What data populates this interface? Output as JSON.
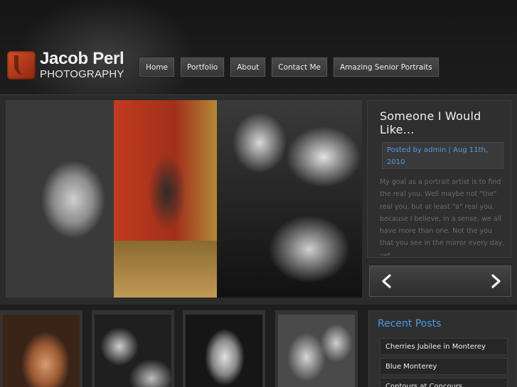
{
  "site": {
    "logo_name": "Jacob Perl",
    "logo_sub": "PHOTOGRAPHY"
  },
  "nav": [
    {
      "label": "Home"
    },
    {
      "label": "Portfolio"
    },
    {
      "label": "About"
    },
    {
      "label": "Contact Me"
    },
    {
      "label": "Amazing Senior Portraits"
    }
  ],
  "featured": {
    "title": "Someone I Would Like...",
    "meta": "Posted by admin | Aug 11th, 2010",
    "excerpt": "My goal as a portrait artist is to find the real you. Well maybe not \"the\" real you, but at least \"a\" real you, because I believe, in a sense, we all have more than one. Not the you that you see in the mirror every day, yet..."
  },
  "recent_posts": {
    "title": "Recent Posts",
    "items": [
      {
        "label": "Cherries Jubilee in Monterey"
      },
      {
        "label": "Blue Monterey"
      },
      {
        "label": "Contours at Concours"
      }
    ]
  },
  "icons": {
    "prev": "arrow-left-icon",
    "next": "arrow-right-icon"
  },
  "colors": {
    "accent": "#4a9be6",
    "brand": "#c2441f",
    "background": "#1a1a1a"
  }
}
